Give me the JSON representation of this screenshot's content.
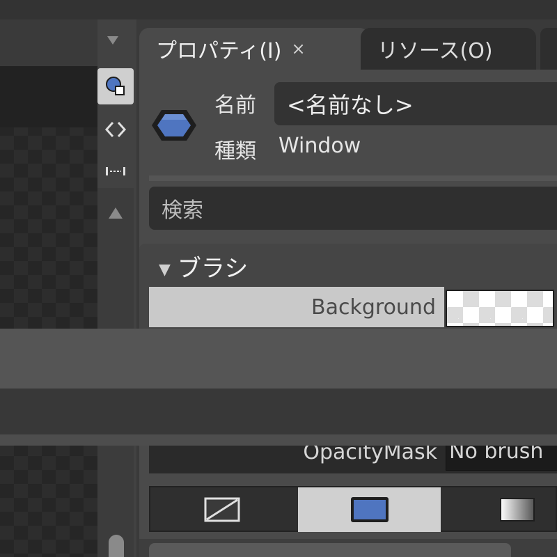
{
  "tabs": [
    {
      "label": "プロパティ(I)",
      "close": "×"
    },
    {
      "label": "リソース(O)"
    }
  ],
  "object": {
    "name_label": "名前",
    "name_value": "<名前なし>",
    "type_label": "種類",
    "type_value": "Window"
  },
  "search": {
    "placeholder": "検索"
  },
  "brush_section": {
    "header": "ブラシ",
    "rows": [
      {
        "label": "Background",
        "swatch": "transparent-checkerboard"
      },
      {
        "label": "OpacityMask",
        "value": "No brush"
      }
    ]
  },
  "brush_types": [
    {
      "name": "no-brush",
      "active": false
    },
    {
      "name": "solid-color-brush",
      "active": true,
      "color": "#4f75c0"
    },
    {
      "name": "gradient-brush",
      "active": false
    }
  ],
  "side_toolbar": {
    "icons": [
      "pin-dropdown-icon",
      "properties-view-icon",
      "code-view-icon",
      "fit-icon",
      "scroll-up-icon"
    ]
  },
  "colors": {
    "accent": "#4f75c0",
    "panel": "#4a4a4a",
    "field": "#333333"
  }
}
